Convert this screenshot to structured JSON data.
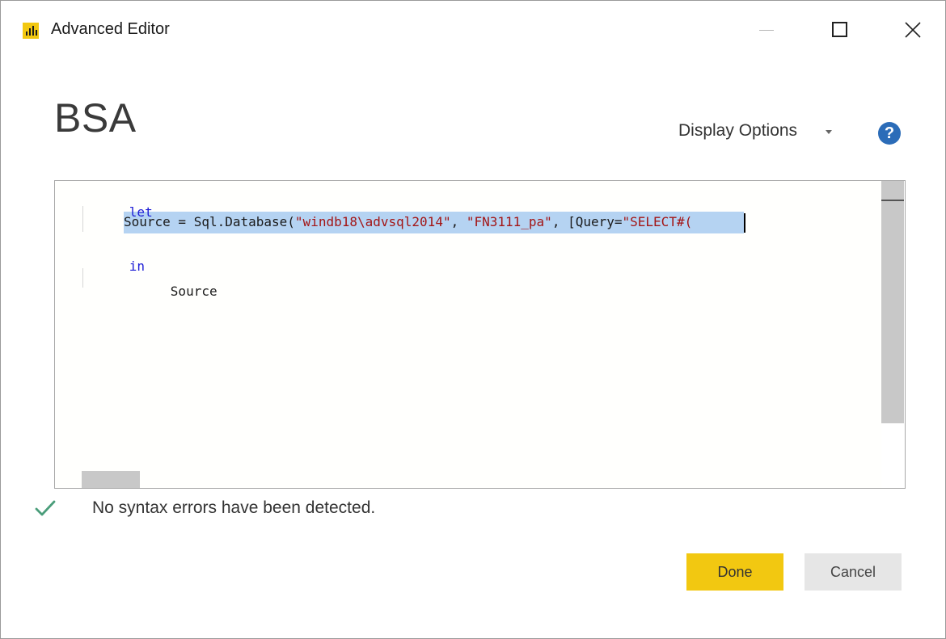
{
  "window": {
    "title": "Advanced Editor",
    "icon": "power-bi-icon",
    "controls": [
      "minimize-icon",
      "maximize-icon",
      "close-icon"
    ]
  },
  "header": {
    "query_name": "BSA",
    "display_options_label": "Display Options",
    "help_label": "?"
  },
  "editor": {
    "lines": [
      {
        "tokens": [
          {
            "type": "keyword",
            "text": "let"
          }
        ]
      },
      {
        "tokens": [
          {
            "type": "plain",
            "text": "Source = Sql.Database("
          },
          {
            "type": "string",
            "text": "\"windb18\\advsql2014\""
          },
          {
            "type": "plain",
            "text": ", "
          },
          {
            "type": "string",
            "text": "\"FN3111_pa\""
          },
          {
            "type": "plain",
            "text": ", ["
          },
          {
            "type": "plain",
            "text": "Query="
          },
          {
            "type": "string",
            "text": "\"SELECT#("
          }
        ]
      },
      {
        "tokens": [
          {
            "type": "keyword",
            "text": "in"
          }
        ]
      },
      {
        "tokens": [
          {
            "type": "plain",
            "text": "Source"
          }
        ]
      }
    ]
  },
  "status": {
    "message": "No syntax errors have been detected.",
    "icon": "checkmark-icon",
    "color": "#4a9d7a"
  },
  "buttons": {
    "done_label": "Done",
    "cancel_label": "Cancel"
  },
  "colors": {
    "accent": "#f2c811",
    "keyword": "#1c1cd6",
    "string": "#a31515",
    "selection": "#b5d3f2",
    "help": "#2b6cb8"
  }
}
